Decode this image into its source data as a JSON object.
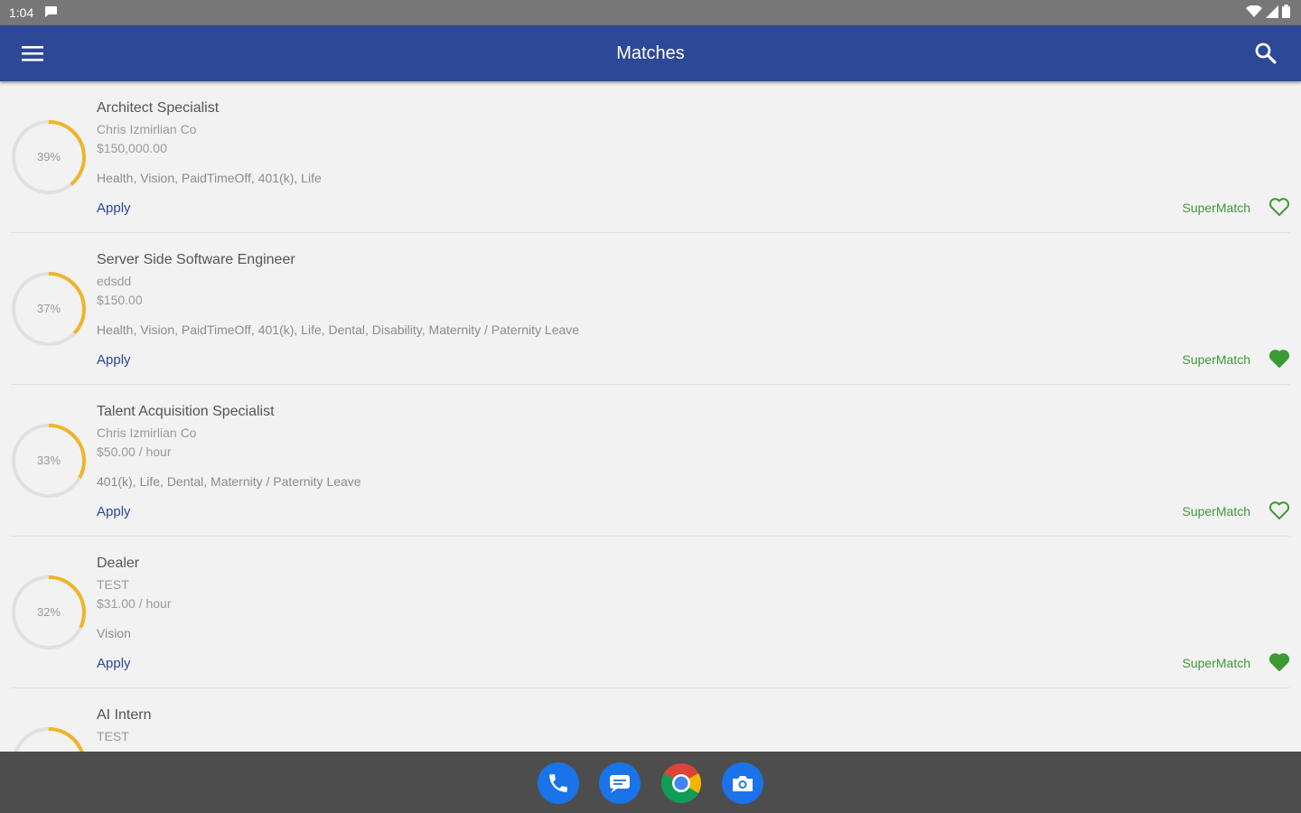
{
  "status_bar": {
    "time": "1:04"
  },
  "app_bar": {
    "title": "Matches"
  },
  "matches": [
    {
      "title": "Architect Specialist",
      "company": "Chris Izmirlian Co",
      "salary": "$150,000.00",
      "benefits": "Health, Vision, PaidTimeOff, 401(k), Life",
      "percent_label": "39%",
      "percent": 39,
      "apply_label": "Apply",
      "supermatch_label": "SuperMatch",
      "favorited": false
    },
    {
      "title": "Server Side Software Engineer",
      "company": "edsdd",
      "salary": "$150.00",
      "benefits": "Health, Vision, PaidTimeOff, 401(k), Life, Dental, Disability, Maternity / Paternity Leave",
      "percent_label": "37%",
      "percent": 37,
      "apply_label": "Apply",
      "supermatch_label": "SuperMatch",
      "favorited": true
    },
    {
      "title": "Talent Acquisition Specialist",
      "company": "Chris Izmirlian Co",
      "salary": "$50.00 / hour",
      "benefits": "401(k), Life, Dental, Maternity / Paternity Leave",
      "percent_label": "33%",
      "percent": 33,
      "apply_label": "Apply",
      "supermatch_label": "SuperMatch",
      "favorited": false
    },
    {
      "title": "Dealer",
      "company": "TEST",
      "salary": "$31.00 / hour",
      "benefits": "Vision",
      "percent_label": "32%",
      "percent": 32,
      "apply_label": "Apply",
      "supermatch_label": "SuperMatch",
      "favorited": true
    },
    {
      "title": "AI Intern",
      "company": "TEST",
      "percent": 30
    }
  ],
  "colors": {
    "app_bar": "#2c4896",
    "accent": "#2c4896",
    "ring_progress": "#f0b429",
    "ring_track": "#e0e0e0",
    "supermatch": "#3c9a35"
  },
  "dock": {
    "apps": [
      "phone-icon",
      "messages-icon",
      "chrome-icon",
      "camera-icon"
    ]
  }
}
